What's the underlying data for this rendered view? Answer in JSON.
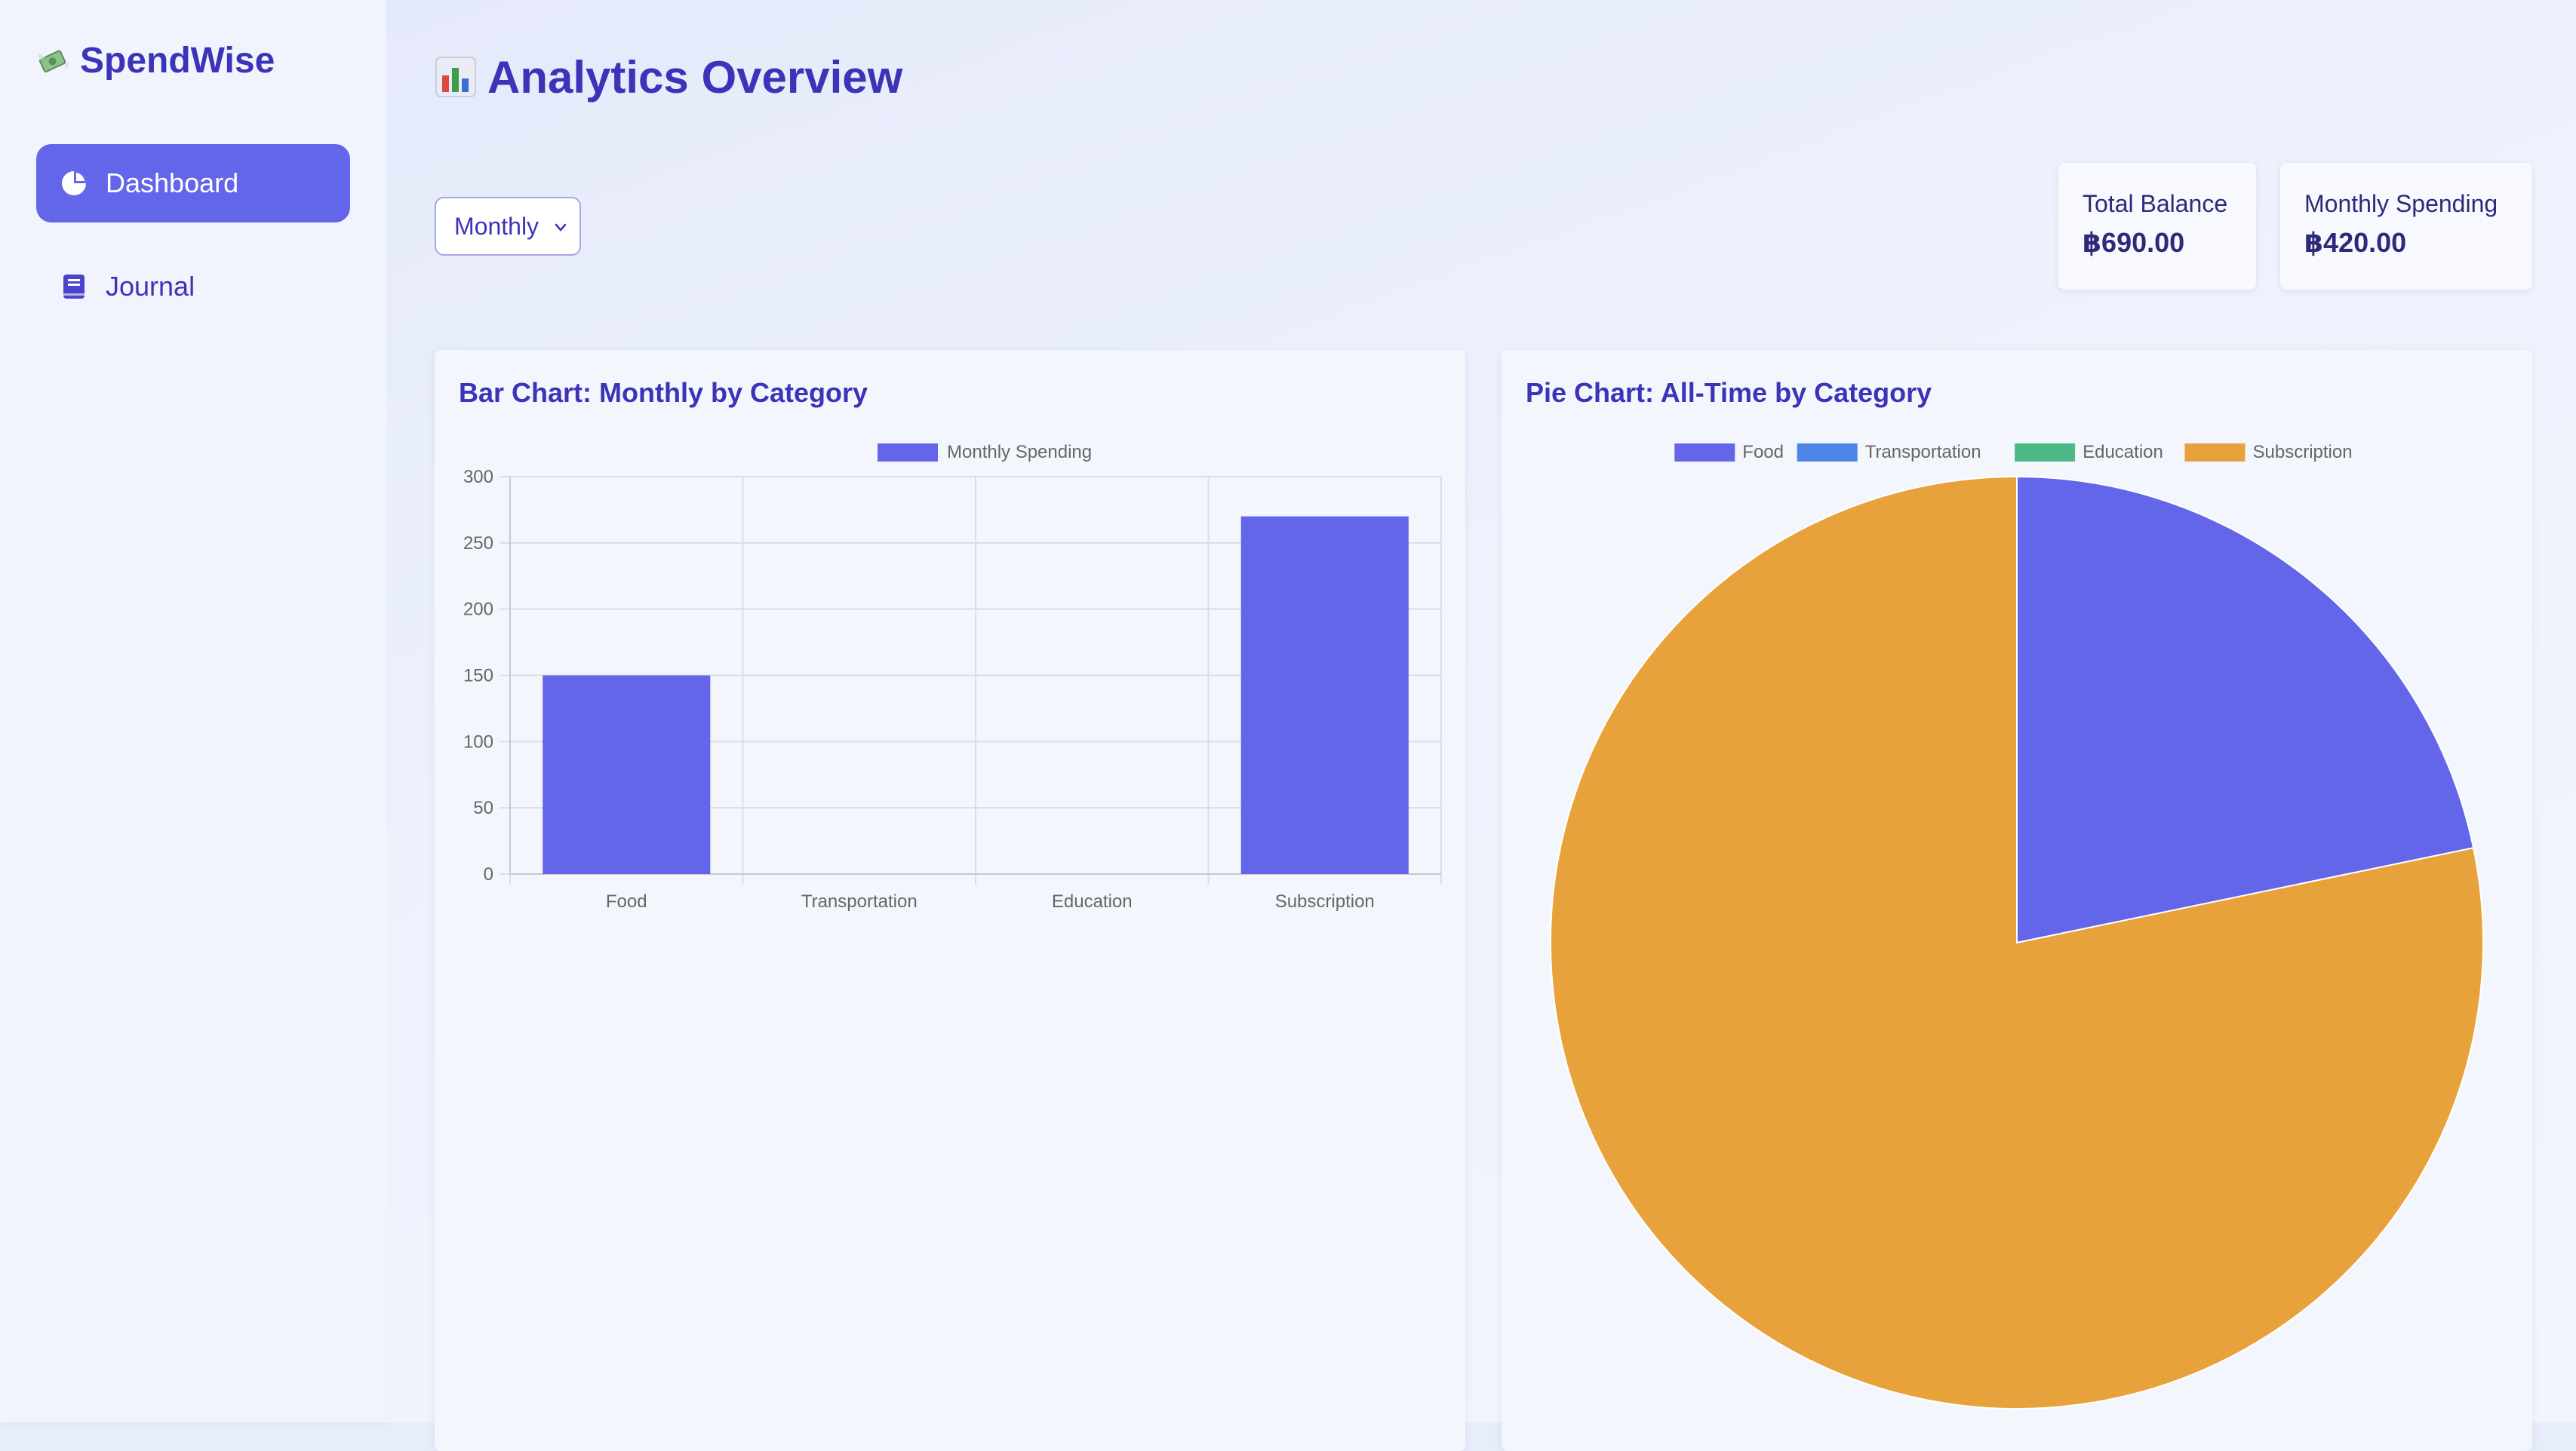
{
  "app": {
    "name": "SpendWise"
  },
  "sidebar": {
    "items": [
      {
        "label": "Dashboard",
        "icon": "pie-chart-icon",
        "active": true
      },
      {
        "label": "Journal",
        "icon": "book-icon",
        "active": false
      }
    ]
  },
  "page": {
    "title": "Analytics Overview",
    "title_icon": "bar-chart-icon"
  },
  "filter": {
    "selected": "Monthly"
  },
  "stats": [
    {
      "label": "Total Balance",
      "value": "฿690.00"
    },
    {
      "label": "Monthly Spending",
      "value": "฿420.00"
    }
  ],
  "colors": {
    "accent": "#6366e9",
    "brand_text": "#3b34b8",
    "food": "#6366e9",
    "transportation": "#4d85e8",
    "education": "#4eb986",
    "subscription": "#e8a23b"
  },
  "chart_data": [
    {
      "type": "bar",
      "title": "Bar Chart: Monthly by Category",
      "categories": [
        "Food",
        "Transportation",
        "Education",
        "Subscription"
      ],
      "series": [
        {
          "name": "Monthly Spending",
          "values": [
            150,
            0,
            0,
            270
          ],
          "color": "#6366e9"
        }
      ],
      "ylim": [
        0,
        300
      ],
      "yticks": [
        0,
        50,
        100,
        150,
        200,
        250,
        300
      ],
      "grid": true,
      "legend": "top-center"
    },
    {
      "type": "pie",
      "title": "Pie Chart: All-Time by Category",
      "labels": [
        "Food",
        "Transportation",
        "Education",
        "Subscription"
      ],
      "values": [
        150,
        0,
        0,
        540
      ],
      "colors": [
        "#6366e9",
        "#4d85e8",
        "#4eb986",
        "#e8a23b"
      ],
      "legend": "top-center"
    }
  ]
}
